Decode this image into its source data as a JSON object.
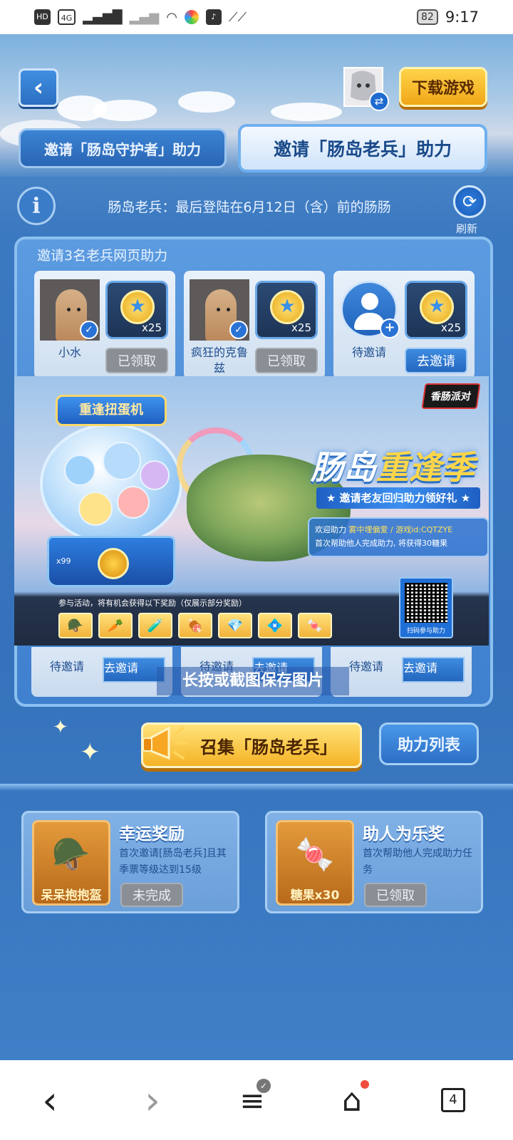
{
  "status_bar": {
    "left_icons": [
      "HD",
      "4G",
      "signal-icon",
      "signal-off-icon",
      "wifi-icon",
      "app-icon",
      "tiktok-icon",
      "link-icon"
    ],
    "hd_label": "HD",
    "network_label": "4G",
    "battery": "82",
    "time": "9:17"
  },
  "header": {
    "download_label": "下载游戏"
  },
  "tabs": [
    {
      "label": "邀请「肠岛守护者」助力",
      "active": false
    },
    {
      "label": "邀请「肠岛老兵」助力",
      "active": true
    }
  ],
  "notice": {
    "info_glyph": "i",
    "text": "肠岛老兵：最后登陆在6月12日（含）前的肠肠",
    "refresh_label": "刷新"
  },
  "invite_panel": {
    "title": "邀请3名老兵网页助力",
    "helpers": [
      {
        "name": "小水",
        "reward_qty": "x25",
        "button": "已领取",
        "state": "claimed"
      },
      {
        "name": "疯狂的克鲁兹",
        "reward_qty": "x25",
        "button": "已领取",
        "state": "claimed"
      },
      {
        "name": "待邀请",
        "reward_qty": "x25",
        "button": "去邀请",
        "state": "pending"
      }
    ],
    "helpers_row2": [
      {
        "name": "待邀请",
        "button": "去邀请"
      },
      {
        "name": "待邀请",
        "button": "去邀请"
      },
      {
        "name": "待邀请",
        "button": "去邀请"
      }
    ]
  },
  "poster": {
    "machine_sign": "重逢扭蛋机",
    "machine_qty": "x99",
    "logo": "香肠派对",
    "headline_a": "肠岛",
    "headline_b": "重逢季",
    "ribbon": "★ 邀请老友回归助力领好礼 ★",
    "welcome_prefix": "欢迎助力",
    "welcome_user": "雾中埋偏爱 / 游戏id:CQTZYE",
    "welcome_line2": "首次帮助他人完成助力, 将获得30糖果",
    "caption": "参与活动，将有机会获得以下奖励（仅展示部分奖励）",
    "qr_label": "扫码参与助力",
    "reward_chips": [
      "🪖",
      "🥕",
      "🧪",
      "🍖",
      "💎",
      "💠",
      "🍬"
    ]
  },
  "save_hint": "长按或截图保存图片",
  "summon_label": "召集「肠岛老兵」",
  "helplist_label": "助力列表",
  "rewards": [
    {
      "title": "幸运奖励",
      "desc": "首次邀请[肠岛老兵]且其季票等级达到15级",
      "item_label": "呆呆抱抱盔",
      "item_art": "🪖",
      "state": "未完成"
    },
    {
      "title": "助人为乐奖",
      "desc": "首次帮助他人完成助力任务",
      "item_label": "糖果x30",
      "item_art": "🍬",
      "state": "已领取"
    }
  ],
  "nav": {
    "back": "‹",
    "forward": "›",
    "menu": "≡",
    "home": "⌂",
    "tabs_count": "4"
  },
  "colors": {
    "accent_blue": "#3572bb",
    "gold": "#f5b326",
    "claimed_gray": "#8a8f96"
  }
}
